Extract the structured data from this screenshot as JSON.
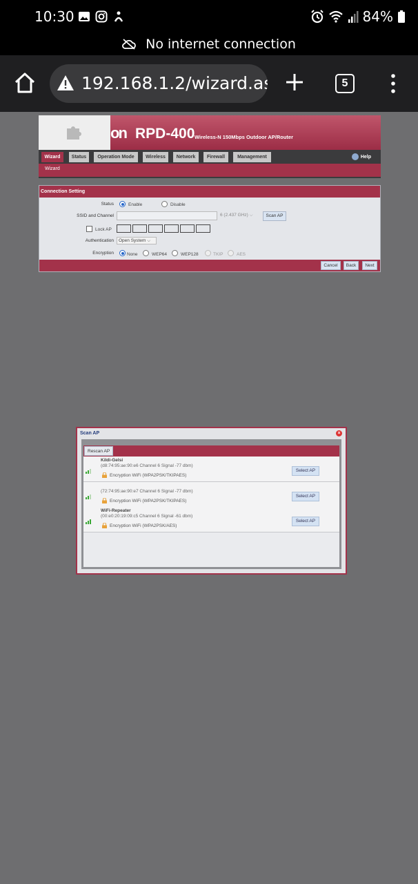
{
  "status_bar": {
    "time": "10:30",
    "battery": "84%",
    "icons_left": [
      "gallery-icon",
      "instagram-icon",
      "wellbeing-icon"
    ],
    "icons_right": [
      "alarm-icon",
      "wifi-icon",
      "signal-icon",
      "battery-icon"
    ]
  },
  "network_banner": {
    "text": "No internet connection"
  },
  "browser": {
    "url": "192.168.1.2/wizard.as",
    "tab_count": "5"
  },
  "router": {
    "logo_text": "on",
    "model": "RPD-400",
    "subtitle": "Wireless-N 150Mbps Outdoor AP/Router",
    "nav_tabs": [
      {
        "label": "Wizard",
        "active": true
      },
      {
        "label": "Status",
        "active": false
      },
      {
        "label": "Operation Mode",
        "active": false
      },
      {
        "label": "Wireless",
        "active": false
      },
      {
        "label": "Network",
        "active": false
      },
      {
        "label": "Firewall",
        "active": false
      },
      {
        "label": "Management",
        "active": false
      }
    ],
    "help_label": "Help",
    "subnav_label": "Wizard",
    "form": {
      "title": "Connection Setting",
      "status_label": "Status",
      "status_options": [
        "Enable",
        "Disable"
      ],
      "status_selected": "Enable",
      "ssid_label": "SSID and Channel",
      "ssid_value": "",
      "channel_value": "6 (2.437 GHz)",
      "scan_ap_button": "Scan AP",
      "lock_ap_label": "Lock AP",
      "lock_ap_checked": false,
      "auth_label": "Authentication",
      "auth_value": "Open System",
      "encryption_label": "Encryption",
      "encryption_options": [
        "None",
        "WEP64",
        "WEP128",
        "TKIP",
        "AES"
      ],
      "encryption_selected": "None",
      "buttons": {
        "cancel": "Cancel",
        "back": "Back",
        "next": "Next"
      }
    }
  },
  "scan_popup": {
    "title": "Scan AP",
    "rescan_button": "Rescan AP",
    "select_label": "Select AP",
    "access_points": [
      {
        "name": "Kildi-Gelsi",
        "info": "(d8:74:95:ae:90:e6 Channel 6 Signal -77 dbm)",
        "encryption": "Encryption WiFi (WPA2PSK/TKIPAES)",
        "select": "Select AP"
      },
      {
        "name": "",
        "info": "(72:74:95:ae:90:e7 Channel 6 Signal -77 dbm)",
        "encryption": "Encryption WiFi (WPA2PSK/TKIPAES)",
        "select": "Select AP"
      },
      {
        "name": "WiFi-Repeater",
        "info": "(00:e0:20:19:09:c5 Channel 6 Signal -61 dbm)",
        "encryption": "Encryption WiFi (WPA2PSK/AES)",
        "select": "Select AP"
      }
    ]
  }
}
